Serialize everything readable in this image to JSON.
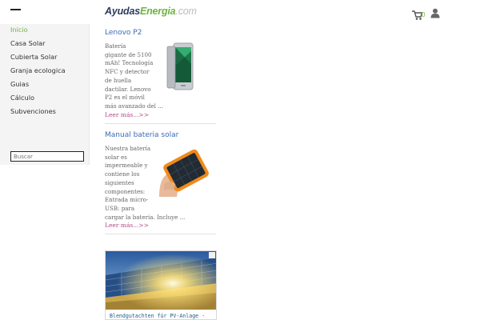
{
  "header": {
    "logo_part1": "Ayudas",
    "logo_part2": "Energia",
    "logo_part3": ".com",
    "cart_count": "0",
    "icons": [
      "hamburger-menu-icon",
      "cart-icon",
      "user-icon"
    ]
  },
  "sidebar": {
    "items": [
      {
        "label": "Inicio",
        "active": true
      },
      {
        "label": "Casa Solar"
      },
      {
        "label": "Cubierta Solar"
      },
      {
        "label": "Granja ecologica"
      },
      {
        "label": "Guias"
      },
      {
        "label": "Cálculo"
      },
      {
        "label": "Subvenciones"
      }
    ],
    "search_placeholder": "Buscar"
  },
  "articles": [
    {
      "title": "Lenovo P2",
      "lines": [
        "Batería",
        "gigante de 5100",
        "mAh! Tecnología",
        "NFC y detector",
        "de huella",
        "dactilar. Lenovo",
        "P2 es el móvil",
        "más avanzado del ..."
      ],
      "more": "Leer más...>>",
      "image": "smartphone"
    },
    {
      "title": "Manual bateria solar",
      "lines": [
        "Nuestra batería",
        "solar es",
        "impermeable y",
        "contiene los",
        "siguientes",
        "componentes:",
        "Entrada micro-",
        "USB: para",
        "cargar la batería. Incluye ..."
      ],
      "more": "Leer más...>>",
      "image": "solar-powerbank"
    }
  ],
  "ad": {
    "caption": "Blendgutachten für PV-Anlage ·"
  },
  "colors": {
    "accent_green": "#6db33f",
    "link_blue": "#3a6bb5",
    "more_link": "#b24a8a",
    "sidebar_bg": "#f4f4f4"
  }
}
